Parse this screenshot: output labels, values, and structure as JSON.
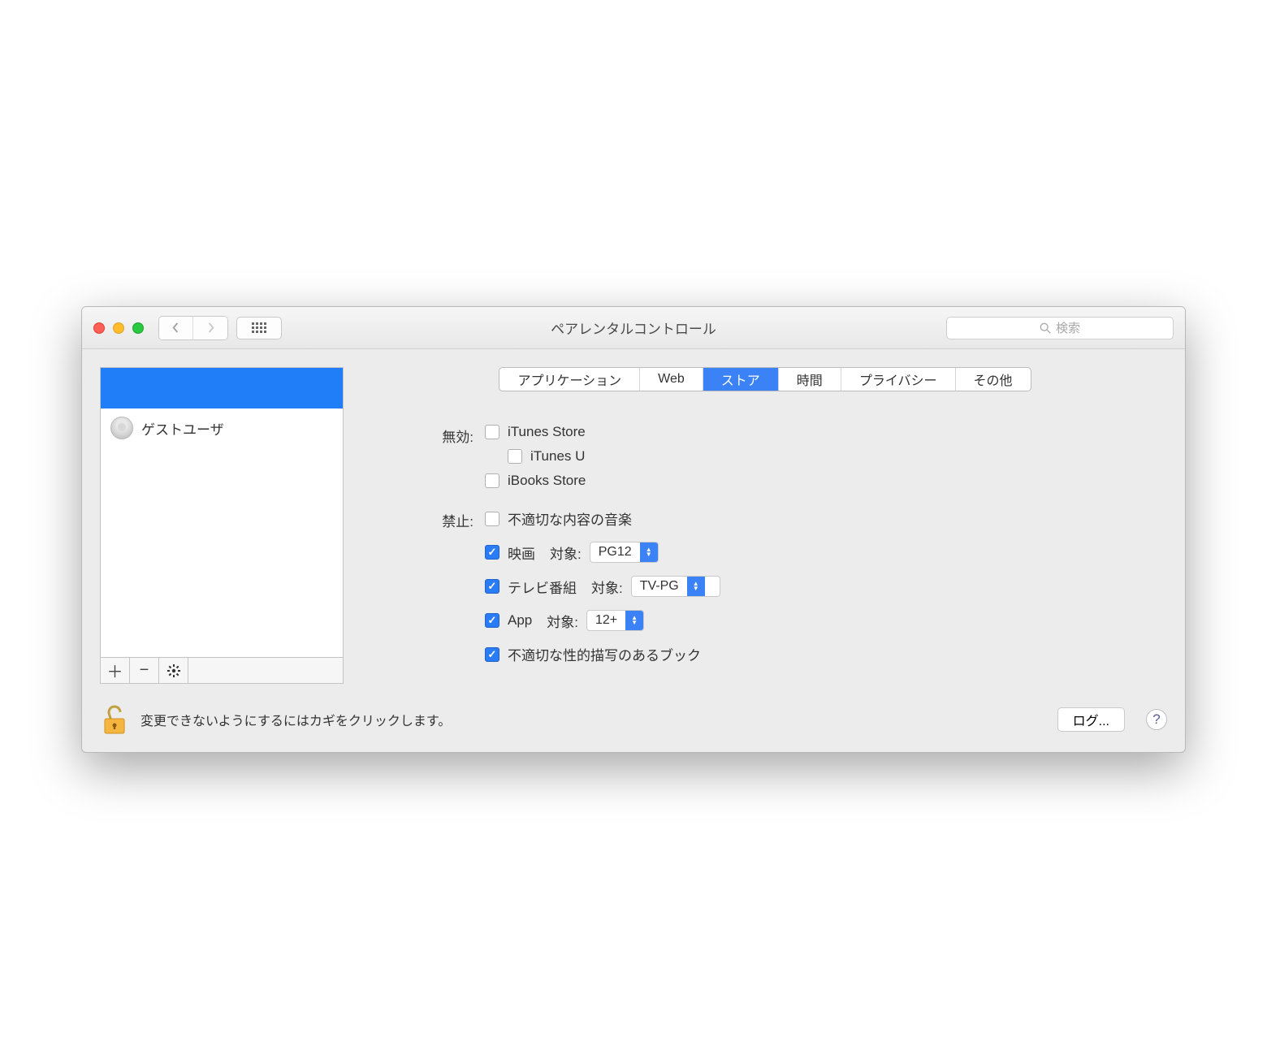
{
  "window": {
    "title": "ペアレンタルコントロール",
    "search_placeholder": "検索"
  },
  "sidebar": {
    "users": [
      {
        "name": "ゲストユーザ"
      }
    ]
  },
  "tabs": [
    {
      "label": "アプリケーション"
    },
    {
      "label": "Web"
    },
    {
      "label": "ストア",
      "active": true
    },
    {
      "label": "時間"
    },
    {
      "label": "プライバシー"
    },
    {
      "label": "その他"
    }
  ],
  "store": {
    "disable_label": "無効:",
    "disable": {
      "itunes_store": "iTunes Store",
      "itunes_u": "iTunes U",
      "ibooks_store": "iBooks Store"
    },
    "restrict_label": "禁止:",
    "restrict": {
      "explicit_music": "不適切な内容の音楽",
      "movies_label": "映画",
      "target_label": "対象:",
      "movies_value": "PG12",
      "tv_label": "テレビ番組",
      "tv_value": "TV-PG",
      "app_label": "App",
      "app_value": "12+",
      "explicit_books": "不適切な性的描写のあるブック"
    }
  },
  "footer": {
    "lock_text": "変更できないようにするにはカギをクリックします。",
    "log_button": "ログ..."
  }
}
